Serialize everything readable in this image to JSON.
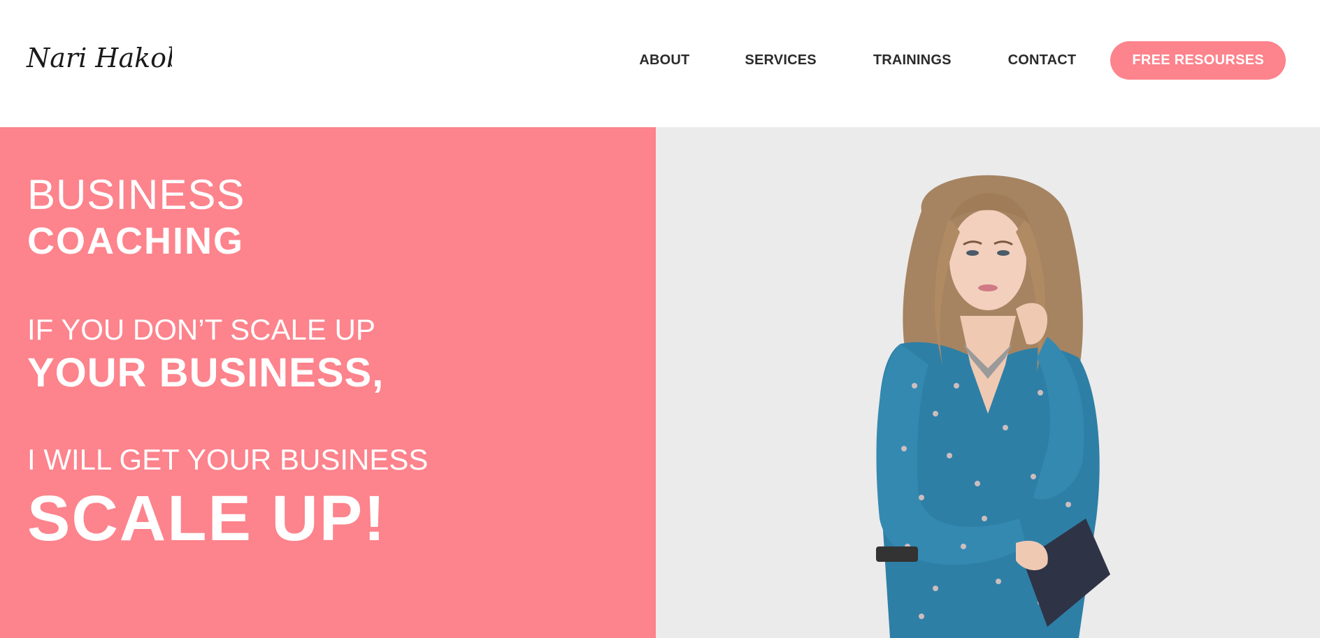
{
  "header": {
    "logo_text": "Nari Hakobian",
    "nav": {
      "about": "ABOUT",
      "services": "SERVICES",
      "trainings": "TRAININGS",
      "contact": "CONTACT"
    },
    "cta_label": "FREE RESOURSES"
  },
  "hero": {
    "line1": "BUSINESS",
    "line2": "COACHING",
    "line3": "IF YOU DON’T SCALE UP",
    "line4": "YOUR BUSINESS,",
    "line5": "I WILL GET YOUR BUSINESS",
    "line6": "SCALE UP!"
  },
  "colors": {
    "accent": "#fd838c",
    "hero_right_bg": "#ebebeb",
    "nav_text": "#2b2b2b",
    "hero_text": "#ffffff"
  },
  "icons": {
    "portrait": "portrait-photo"
  }
}
